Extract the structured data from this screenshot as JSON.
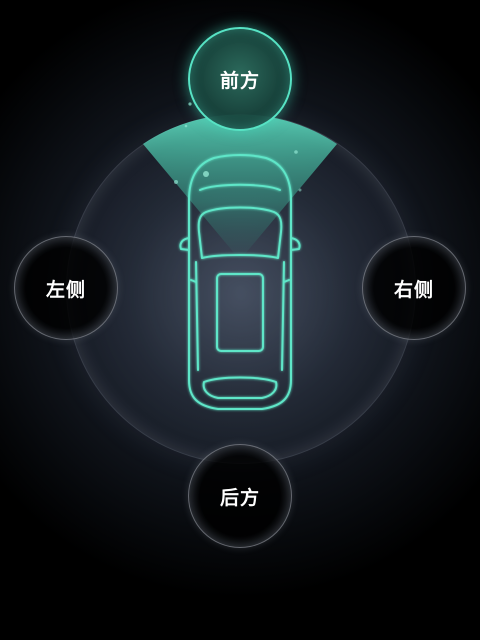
{
  "directions": {
    "front": "前方",
    "left": "左侧",
    "right": "右侧",
    "rear": "后方"
  },
  "selected": "front",
  "colors": {
    "accent": "#57e3c4",
    "background": "#000000",
    "button_border": "#c8cdd7"
  },
  "icons": {
    "vehicle": "car-top-view-icon",
    "sensor": "front-sensor-beam-icon"
  }
}
